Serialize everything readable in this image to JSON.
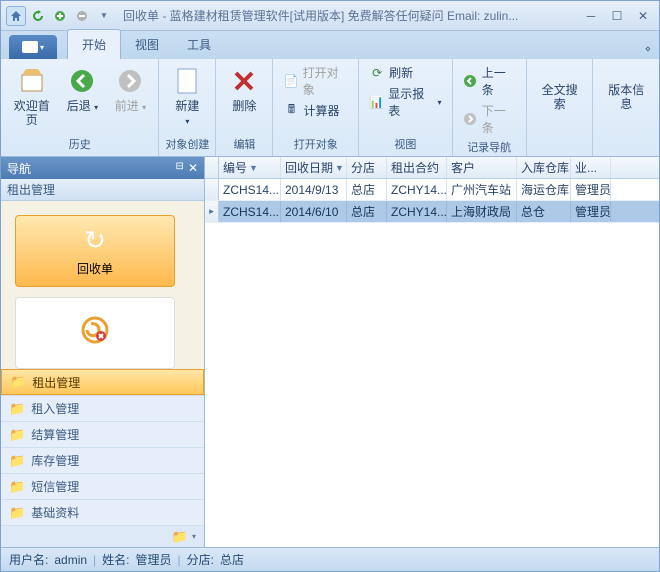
{
  "titlebar": {
    "title": "回收单 - 蓝格建材租赁管理软件[试用版本] 免费解答任何疑问 Email: zulin..."
  },
  "tabs": {
    "start": "开始",
    "view": "视图",
    "tools": "工具"
  },
  "ribbon": {
    "history": {
      "welcome": "欢迎首页",
      "back": "后退",
      "forward": "前进",
      "label": "历史"
    },
    "create": {
      "new": "新建",
      "label": "对象创建"
    },
    "edit": {
      "delete": "删除",
      "label": "编辑"
    },
    "open": {
      "open_obj": "打开对象",
      "calc": "计算器",
      "label": "打开对象"
    },
    "viewg": {
      "refresh": "刷新",
      "report": "显示报表",
      "label": "视图"
    },
    "nav": {
      "prev": "上一条",
      "next": "下一条",
      "label": "记录导航"
    },
    "search": {
      "fulltext": "全文搜索"
    },
    "ver": {
      "version": "版本信息"
    }
  },
  "nav": {
    "title": "导航",
    "sub": "租出管理",
    "tile1": "回收单",
    "cats": [
      "租出管理",
      "租入管理",
      "结算管理",
      "库存管理",
      "短信管理",
      "基础资料"
    ]
  },
  "grid": {
    "headers": [
      "编号",
      "回收日期",
      "分店",
      "租出合约",
      "客户",
      "入库仓库",
      "业..."
    ],
    "rows": [
      {
        "c": [
          "ZCHS14...",
          "2014/9/13",
          "总店",
          "ZCHY14...",
          "广州汽车站",
          "海运仓库",
          "管理员"
        ],
        "sel": false
      },
      {
        "c": [
          "ZCHS14...",
          "2014/6/10",
          "总店",
          "ZCHY14...",
          "上海财政局",
          "总仓",
          "管理员"
        ],
        "sel": true
      }
    ]
  },
  "status": {
    "user_l": "用户名:",
    "user_v": "admin",
    "name_l": "姓名:",
    "name_v": "管理员",
    "store_l": "分店:",
    "store_v": "总店"
  }
}
